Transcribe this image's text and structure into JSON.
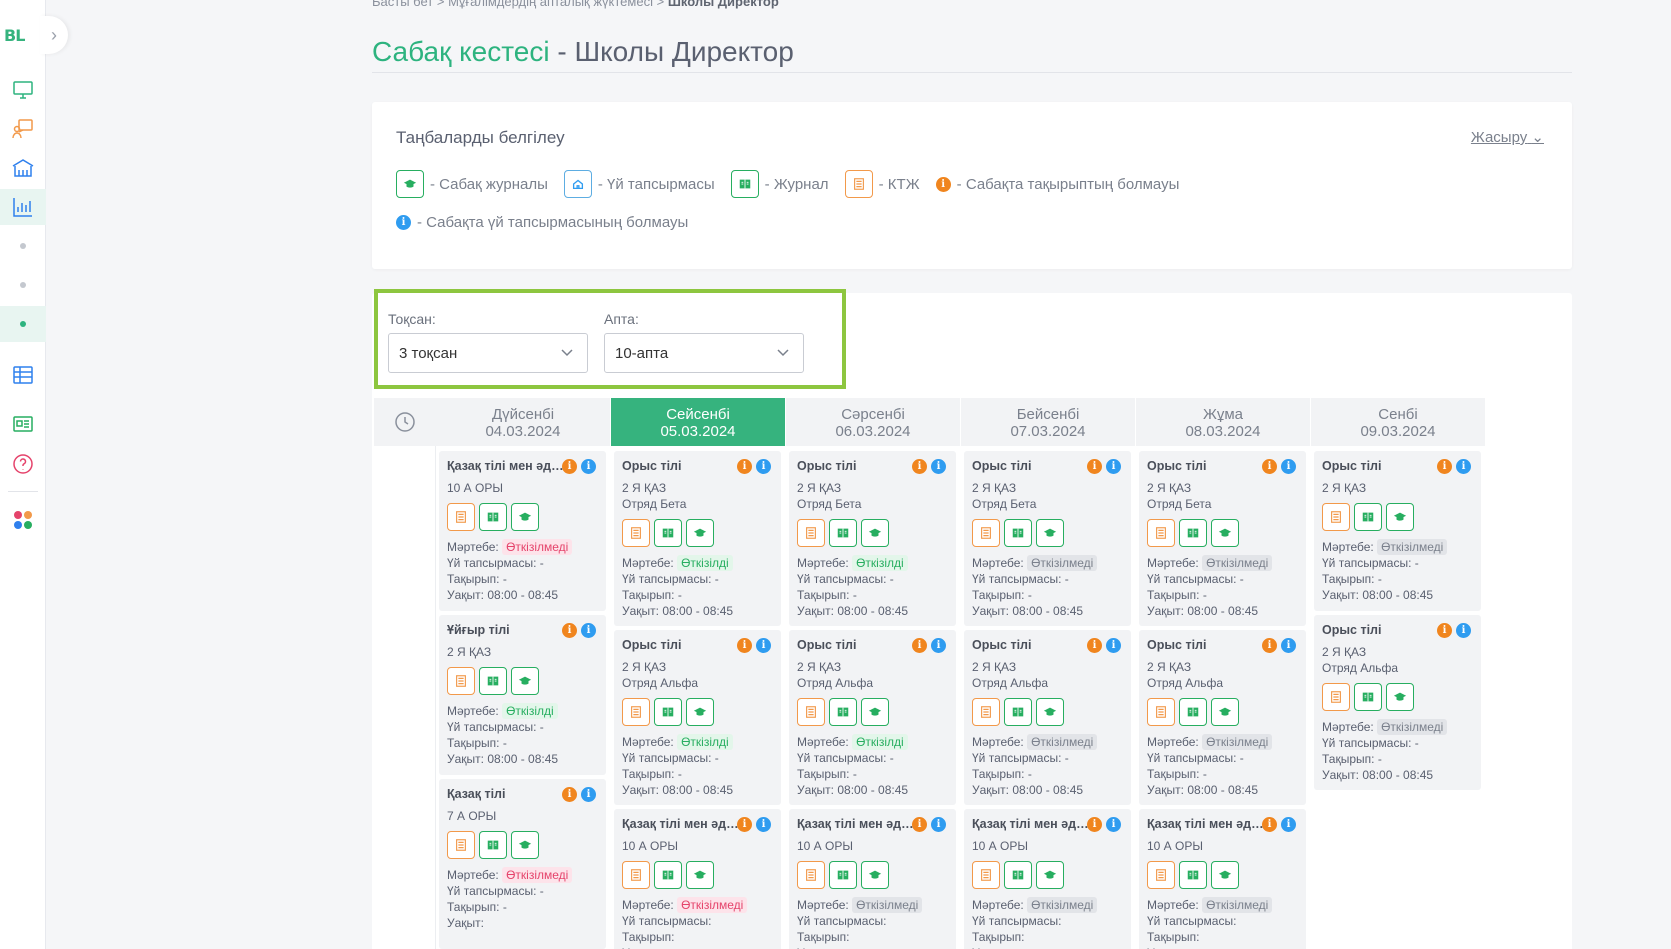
{
  "sidebar": {
    "logo": "BL",
    "collapse_icon": "chevron-right-icon",
    "items": [
      "monitor-icon",
      "teacher-icon",
      "school-icon",
      "chart-icon",
      "dot-icon",
      "dot-icon",
      "dot-icon",
      "table-icon",
      "id-card-icon",
      "help-icon",
      "apps-icon"
    ]
  },
  "breadcrumb": {
    "home": "Басты бет",
    "sep": ">",
    "middle": "Мұғалімдердің апталық жүктемесі",
    "current": "Школы Директор"
  },
  "title": {
    "green": "Сабақ кестесі",
    "dash": " - ",
    "gray": "Школы Директор"
  },
  "legend": {
    "title": "Таңбаларды белгілеу",
    "hide": "Жасыру",
    "items": [
      {
        "label": "- Сабақ журналы"
      },
      {
        "label": "- Үй тапсырмасы"
      },
      {
        "label": "- Журнал"
      },
      {
        "label": "- КТЖ"
      },
      {
        "label": "- Сабақта тақырыптың болмауы"
      },
      {
        "label": "- Сабақта үй тапсырмасының болмауы"
      }
    ]
  },
  "filters": {
    "quarter_label": "Тоқсан:",
    "quarter_value": "3 тоқсан",
    "week_label": "Апта:",
    "week_value": "10-апта"
  },
  "days": [
    {
      "name": "Дүйсенбі",
      "date": "04.03.2024"
    },
    {
      "name": "Сейсенбі",
      "date": "05.03.2024"
    },
    {
      "name": "Сәрсенбі",
      "date": "06.03.2024"
    },
    {
      "name": "Бейсенбі",
      "date": "07.03.2024"
    },
    {
      "name": "Жұма",
      "date": "08.03.2024"
    },
    {
      "name": "Сенбі",
      "date": "09.03.2024"
    }
  ],
  "labels": {
    "status": "Мәртебе:",
    "homework": "Үй тапсырмасы:",
    "topic": "Тақырып:",
    "time": "Уақыт:"
  },
  "lessons": {
    "mon_0": {
      "subject": "Қазақ тілі мен әде...",
      "class": "10 А ОРЫ",
      "group": "",
      "status": "Өткізілмеді",
      "homework": "-",
      "topic": "-",
      "time": "08:00 - 08:45"
    },
    "mon_1": {
      "subject": "Ұйғыр тілі",
      "class": "2 Я ҚАЗ",
      "group": "",
      "status": "Өткізілді",
      "homework": "-",
      "topic": "-",
      "time": "08:00 - 08:45"
    },
    "mon_2": {
      "subject": "Қазақ тілі",
      "class": "7 А ОРЫ",
      "group": "",
      "status": "Өткізілмеді",
      "homework": "-",
      "topic": "-",
      "time": ""
    },
    "tue_0": {
      "subject": "Орыс тілі",
      "class": "2 Я ҚАЗ",
      "group": "Отряд Бета",
      "status": "Өткізілді",
      "homework": "-",
      "topic": "-",
      "time": "08:00 - 08:45"
    },
    "tue_1": {
      "subject": "Орыс тілі",
      "class": "2 Я ҚАЗ",
      "group": "Отряд Альфа",
      "status": "Өткізілді",
      "homework": "-",
      "topic": "-",
      "time": "08:00 - 08:45"
    },
    "tue_2": {
      "subject": "Қазақ тілі мен әде...",
      "class": "10 А ОРЫ",
      "group": "",
      "status": "Өткізілмеді",
      "homework": "",
      "topic": "",
      "time": ""
    },
    "wed_0": {
      "subject": "Орыс тілі",
      "class": "2 Я ҚАЗ",
      "group": "Отряд Бета",
      "status": "Өткізілді",
      "homework": "-",
      "topic": "-",
      "time": "08:00 - 08:45"
    },
    "wed_1": {
      "subject": "Орыс тілі",
      "class": "2 Я ҚАЗ",
      "group": "Отряд Альфа",
      "status": "Өткізілді",
      "homework": "-",
      "topic": "-",
      "time": "08:00 - 08:45"
    },
    "wed_2": {
      "subject": "Қазақ тілі мен әде...",
      "class": "10 А ОРЫ",
      "group": "",
      "status": "Өткізілмеді",
      "homework": "",
      "topic": "",
      "time": ""
    },
    "thu_0": {
      "subject": "Орыс тілі",
      "class": "2 Я ҚАЗ",
      "group": "Отряд Бета",
      "status": "Өткізілмеді",
      "homework": "-",
      "topic": "-",
      "time": "08:00 - 08:45"
    },
    "thu_1": {
      "subject": "Орыс тілі",
      "class": "2 Я ҚАЗ",
      "group": "Отряд Альфа",
      "status": "Өткізілмеді",
      "homework": "-",
      "topic": "-",
      "time": "08:00 - 08:45"
    },
    "thu_2": {
      "subject": "Қазақ тілі мен әде...",
      "class": "10 А ОРЫ",
      "group": "",
      "status": "Өткізілмеді",
      "homework": "",
      "topic": "",
      "time": ""
    },
    "fri_0": {
      "subject": "Орыс тілі",
      "class": "2 Я ҚАЗ",
      "group": "Отряд Бета",
      "status": "Өткізілмеді",
      "homework": "-",
      "topic": "-",
      "time": "08:00 - 08:45"
    },
    "fri_1": {
      "subject": "Орыс тілі",
      "class": "2 Я ҚАЗ",
      "group": "Отряд Альфа",
      "status": "Өткізілмеді",
      "homework": "-",
      "topic": "-",
      "time": "08:00 - 08:45"
    },
    "fri_2": {
      "subject": "Қазақ тілі мен әде...",
      "class": "10 А ОРЫ",
      "group": "",
      "status": "Өткізілмеді",
      "homework": "",
      "topic": "",
      "time": ""
    },
    "sat_0": {
      "subject": "Орыс тілі",
      "class": "2 Я ҚАЗ",
      "group": "",
      "status": "Өткізілмеді",
      "homework": "-",
      "topic": "-",
      "time": "08:00 - 08:45"
    },
    "sat_1": {
      "subject": "Орыс тілі",
      "class": "2 Я ҚАЗ",
      "group": "Отряд Альфа",
      "status": "Өткізілмеді",
      "homework": "-",
      "topic": "-",
      "time": "08:00 - 08:45"
    }
  },
  "colors": {
    "accent": "#36b37e",
    "filter_highlight": "#8dc63f",
    "status_red": "#e5436b",
    "status_green": "#27ae60"
  }
}
